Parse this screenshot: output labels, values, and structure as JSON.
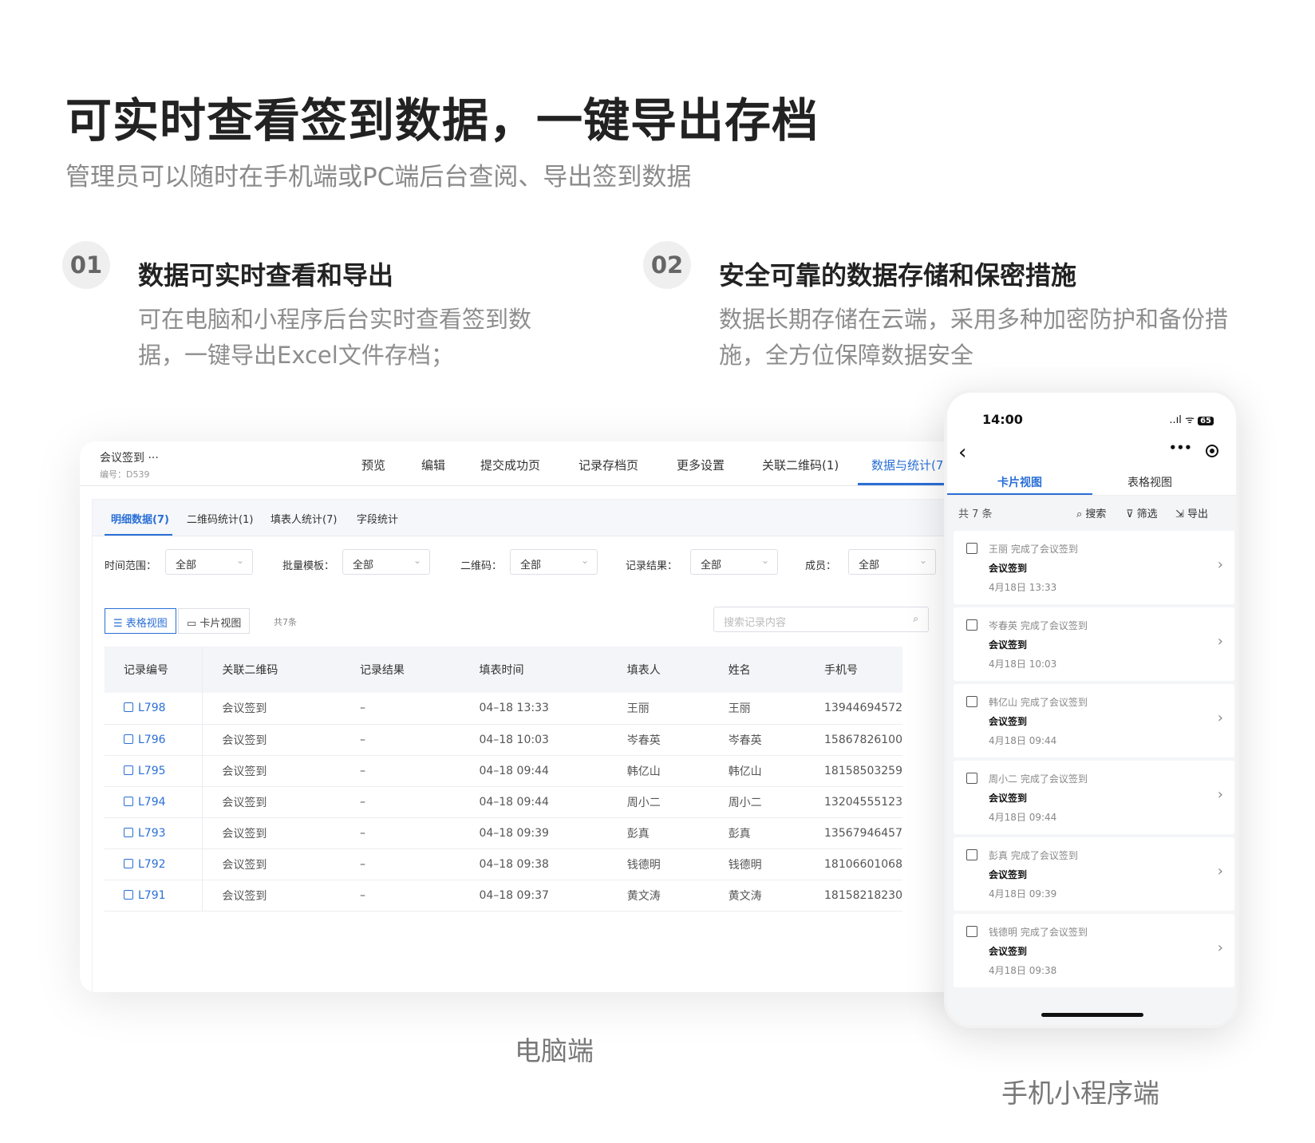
{
  "headline": "可实时查看签到数据，一键导出存档",
  "subline": "管理员可以随时在手机端或PC端后台查阅、导出签到数据",
  "features": [
    {
      "num": "01",
      "title": "数据可实时查看和导出",
      "desc": "可在电脑和小程序后台实时查看签到数据，一键导出Excel文件存档；"
    },
    {
      "num": "02",
      "title": "安全可靠的数据存储和保密措施",
      "desc": "数据长期存储在云端，采用多种加密防护和备份措施，全方位保障数据安全"
    }
  ],
  "pc": {
    "form_name": "会议签到",
    "more": "···",
    "code": "编号：D539",
    "nav": [
      "预览",
      "编辑",
      "提交成功页",
      "记录存档页",
      "更多设置",
      "关联二维码(1)",
      "数据与统计(7"
    ],
    "active_nav": "数据与统计(7",
    "tabs": [
      "明细数据(7)",
      "二维码统计(1)",
      "填表人统计(7)",
      "字段统计"
    ],
    "filters": [
      {
        "label": "时间范围：",
        "value": "全部"
      },
      {
        "label": "批量模板：",
        "value": "全部"
      },
      {
        "label": "二维码：",
        "value": "全部"
      },
      {
        "label": "记录结果：",
        "value": "全部"
      },
      {
        "label": "成员：",
        "value": "全部"
      }
    ],
    "view_table": "表格视图",
    "view_card": "卡片视图",
    "count": "共7条",
    "search_placeholder": "搜索记录内容",
    "columns": [
      "记录编号",
      "关联二维码",
      "记录结果",
      "填表时间",
      "填表人",
      "姓名",
      "手机号"
    ],
    "rows": [
      [
        "L798",
        "会议签到",
        "–",
        "04–18 13:33",
        "王丽",
        "王丽",
        "13944694572"
      ],
      [
        "L796",
        "会议签到",
        "–",
        "04–18 10:03",
        "岑春英",
        "岑春英",
        "15867826100"
      ],
      [
        "L795",
        "会议签到",
        "–",
        "04–18 09:44",
        "韩亿山",
        "韩亿山",
        "18158503259"
      ],
      [
        "L794",
        "会议签到",
        "–",
        "04–18 09:44",
        "周小二",
        "周小二",
        "13204555123"
      ],
      [
        "L793",
        "会议签到",
        "–",
        "04–18 09:39",
        "彭真",
        "彭真",
        "13567946457"
      ],
      [
        "L792",
        "会议签到",
        "–",
        "04–18 09:38",
        "钱德明",
        "钱德明",
        "18106601068"
      ],
      [
        "L791",
        "会议签到",
        "–",
        "04–18 09:37",
        "黄文涛",
        "黄文涛",
        "18158218230"
      ]
    ],
    "caption": "电脑端"
  },
  "phone": {
    "time": "14:00",
    "signal": "..ıl",
    "wifi": "ᯤ",
    "battery": "65",
    "back": "‹",
    "tab_card": "卡片视图",
    "tab_table": "表格视图",
    "total": "共 7 条",
    "search": "搜索",
    "filter": "筛选",
    "export": "导出",
    "cards": [
      {
        "who": "王丽 完成了会议签到",
        "what": "会议签到",
        "when": "4月18日 13:33"
      },
      {
        "who": "岑春英 完成了会议签到",
        "what": "会议签到",
        "when": "4月18日 10:03"
      },
      {
        "who": "韩亿山 完成了会议签到",
        "what": "会议签到",
        "when": "4月18日 09:44"
      },
      {
        "who": "周小二 完成了会议签到",
        "what": "会议签到",
        "when": "4月18日 09:44"
      },
      {
        "who": "彭真 完成了会议签到",
        "what": "会议签到",
        "when": "4月18日 09:39"
      },
      {
        "who": "钱德明 完成了会议签到",
        "what": "会议签到",
        "when": "4月18日 09:38"
      }
    ],
    "caption": "手机小程序端"
  },
  "colors": {
    "accent": "#2a6fd6",
    "muted": "#8a8a8a"
  }
}
